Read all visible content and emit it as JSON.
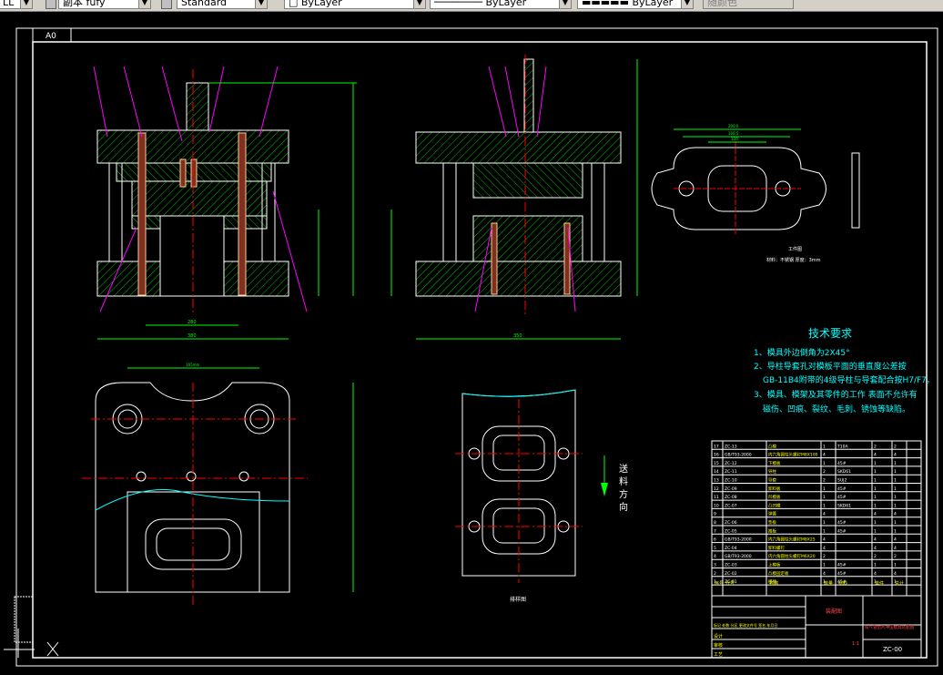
{
  "toolbar": {
    "layer_partial": "LL",
    "textstyle_label": "副本 fufy",
    "dimstyle_label": "Standard",
    "color_label": "ByLayer",
    "linetype_label": "ByLayer",
    "lineweight_label": "ByLayer",
    "plotstyle_label": "随颜色"
  },
  "drawing": {
    "sheet_size": "A0",
    "tech_title": "技术要求",
    "tech_notes": [
      "1、模具外边倒角为2X45°",
      "2、导柱导套孔对模板平面的垂直度公差按",
      "GB-11B4附带的4级导柱与导套配合按H7/F7。",
      "3、模具、模架及其零件的工作 表面不允许有",
      "磁伤、凹痕、裂纹、毛刺、锈蚀等缺陷。"
    ],
    "feed_direction_label": [
      "送",
      "料",
      "方",
      "向"
    ],
    "workpiece_title": "工件图",
    "workpiece_spec": "材料：不锈钢  厚度：3mm",
    "strip_title": "排样图",
    "bom_rows": [
      {
        "no": "17",
        "code": "ZC-13",
        "name": "凸模",
        "qty": "1",
        "material": "T10A",
        "w": "2",
        "t": "2"
      },
      {
        "no": "16",
        "code": "GB/T93-2000",
        "name": "内六角圆柱头螺钉M8X100",
        "qty": "4",
        "material": "",
        "w": "4",
        "t": "4"
      },
      {
        "no": "15",
        "code": "ZC-12",
        "name": "下模板",
        "qty": "1",
        "material": "45#",
        "w": "1",
        "t": "1"
      },
      {
        "no": "14",
        "code": "ZC-11",
        "name": "导柱",
        "qty": "2",
        "material": "SKD61",
        "w": "1",
        "t": "1"
      },
      {
        "no": "13",
        "code": "ZC-10",
        "name": "导套",
        "qty": "2",
        "material": "SUJ2",
        "w": "1",
        "t": "1"
      },
      {
        "no": "12",
        "code": "ZC-09",
        "name": "卸料板",
        "qty": "1",
        "material": "45#",
        "w": "1",
        "t": "1"
      },
      {
        "no": "11",
        "code": "ZC-08",
        "name": "凹模板",
        "qty": "1",
        "material": "45#",
        "w": "1",
        "t": "1"
      },
      {
        "no": "10",
        "code": "ZC-07",
        "name": "凸凹模",
        "qty": "1",
        "material": "SKD61",
        "w": "1",
        "t": "1"
      },
      {
        "no": "9",
        "code": "",
        "name": "弹簧",
        "qty": "4",
        "material": "",
        "w": "4",
        "t": "4"
      },
      {
        "no": "8",
        "code": "ZC-06",
        "name": "垫板",
        "qty": "1",
        "material": "45#",
        "w": "1",
        "t": "1"
      },
      {
        "no": "7",
        "code": "ZC-05",
        "name": "推板",
        "qty": "1",
        "material": "45#",
        "w": "1",
        "t": "1"
      },
      {
        "no": "6",
        "code": "GB/T93-2000",
        "name": "内六角圆柱头螺钉M8X25",
        "qty": "4",
        "material": "",
        "w": "4",
        "t": "4"
      },
      {
        "no": "5",
        "code": "ZC-04",
        "name": "卸料螺钉",
        "qty": "4",
        "material": "",
        "w": "4",
        "t": "4"
      },
      {
        "no": "4",
        "code": "GB/T93-2000",
        "name": "内六角圆柱头螺钉M6X20",
        "qty": "2",
        "material": "",
        "w": "2",
        "t": "2"
      },
      {
        "no": "3",
        "code": "ZC-03",
        "name": "上模板",
        "qty": "1",
        "material": "45#",
        "w": "1",
        "t": "1"
      },
      {
        "no": "2",
        "code": "ZC-02",
        "name": "凸模固定板",
        "qty": "4",
        "material": "45#",
        "w": "4",
        "t": "4"
      },
      {
        "no": "1",
        "code": "ZC-01",
        "name": "模柄",
        "qty": "1",
        "material": "45#",
        "w": "1",
        "t": "1"
      }
    ],
    "bom_header": {
      "no": "序号",
      "code": "代号",
      "name": "名称",
      "qty": "数量",
      "material": "材料",
      "w": "单件",
      "t": "总计"
    },
    "title_block": {
      "assembly_label": "装配图",
      "part_title": "排气管垫片冲压模具装配图",
      "drawing_no": "ZC-00",
      "scale": "1:1",
      "rows": [
        "标记 处数 分区 更改文件号 签名 年月日",
        "设计",
        "审核",
        "工艺"
      ]
    },
    "dims": {
      "front_total_width": "380",
      "front_bottom_width": "280",
      "side_total_width": "350",
      "plan_width": "165mm",
      "workpiece_w1": "200.0",
      "workpiece_w2": "168.5",
      "workpiece_w3": "120"
    },
    "colors": {
      "outline": "#ffffff",
      "hatch": "#00ff00",
      "dim": "#00ff00",
      "leader": "#ff00ff",
      "centerline": "#ff0000",
      "text_yellow": "#ffff00",
      "text_cyan": "#00ffff",
      "background": "#000000"
    }
  }
}
